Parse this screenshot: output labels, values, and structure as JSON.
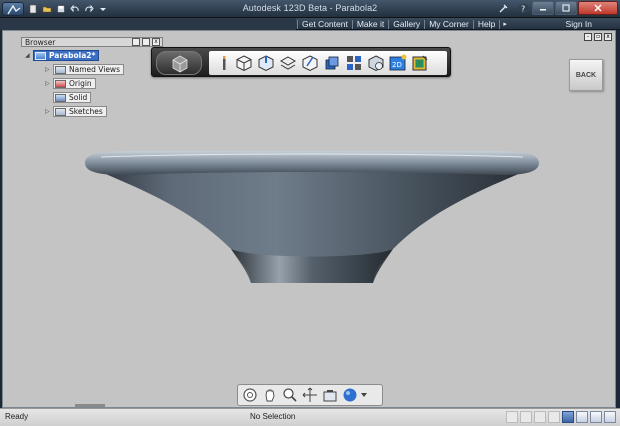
{
  "window": {
    "title": "Autodesk 123D Beta - Parabola2"
  },
  "menu": {
    "items": [
      "Get Content",
      "Make it",
      "Gallery",
      "My Corner",
      "Help"
    ],
    "more_arrow": "▸",
    "sign_in": "Sign In"
  },
  "browser": {
    "label": "Browser",
    "root": "Parabola2*",
    "items": [
      "Named Views",
      "Origin",
      "Solid",
      "Sketches"
    ]
  },
  "view": {
    "back_label": "BACK"
  },
  "status": {
    "left": "Ready",
    "center": "No Selection"
  },
  "colors": {
    "accent": "#3b6fc4",
    "model": "#4f5a66"
  }
}
